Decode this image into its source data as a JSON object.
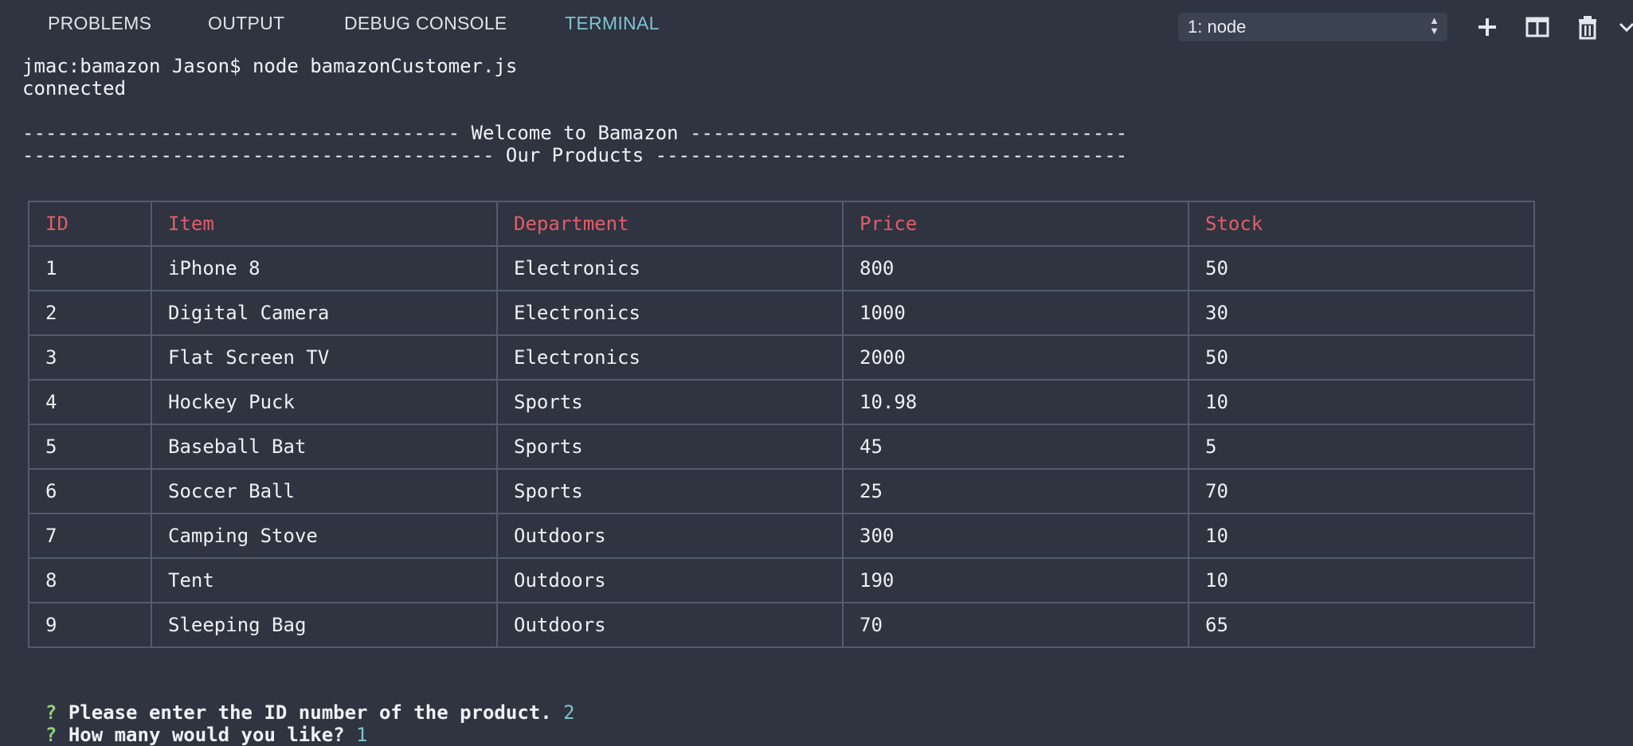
{
  "panel": {
    "tabs": [
      {
        "label": "PROBLEMS"
      },
      {
        "label": "OUTPUT"
      },
      {
        "label": "DEBUG CONSOLE"
      },
      {
        "label": "TERMINAL"
      }
    ],
    "terminal_select": "1: node",
    "icons": [
      "plus-icon",
      "split-icon",
      "trash-icon",
      "chevron-down-icon"
    ],
    "accent_color": "#7ec4cf"
  },
  "terminal": {
    "command_line": "jmac:bamazon Jason$ node bamazonCustomer.js",
    "status_line": "connected",
    "welcome_banner": "-------------------------------------- Welcome to Bamazon --------------------------------------",
    "products_banner": "----------------------------------------- Our Products -----------------------------------------",
    "table": {
      "header_color": "#e25d68",
      "columns": [
        "ID",
        "Item",
        "Department",
        "Price",
        "Stock"
      ],
      "rows": [
        [
          "1",
          "iPhone 8",
          "Electronics",
          "800",
          "50"
        ],
        [
          "2",
          "Digital Camera",
          "Electronics",
          "1000",
          "30"
        ],
        [
          "3",
          "Flat Screen TV",
          "Electronics",
          "2000",
          "50"
        ],
        [
          "4",
          "Hockey Puck",
          "Sports",
          "10.98",
          "10"
        ],
        [
          "5",
          "Baseball Bat",
          "Sports",
          "45",
          "5"
        ],
        [
          "6",
          "Soccer Ball",
          "Sports",
          "25",
          "70"
        ],
        [
          "7",
          "Camping Stove",
          "Outdoors",
          "300",
          "10"
        ],
        [
          "8",
          "Tent",
          "Outdoors",
          "190",
          "10"
        ],
        [
          "9",
          "Sleeping Bag",
          "Outdoors",
          "70",
          "65"
        ]
      ]
    },
    "prompts": [
      {
        "marker": "?",
        "question": "Please enter the ID number of the product.",
        "answer": "2"
      },
      {
        "marker": "?",
        "question": "How many would you like?",
        "answer": "1"
      }
    ]
  }
}
